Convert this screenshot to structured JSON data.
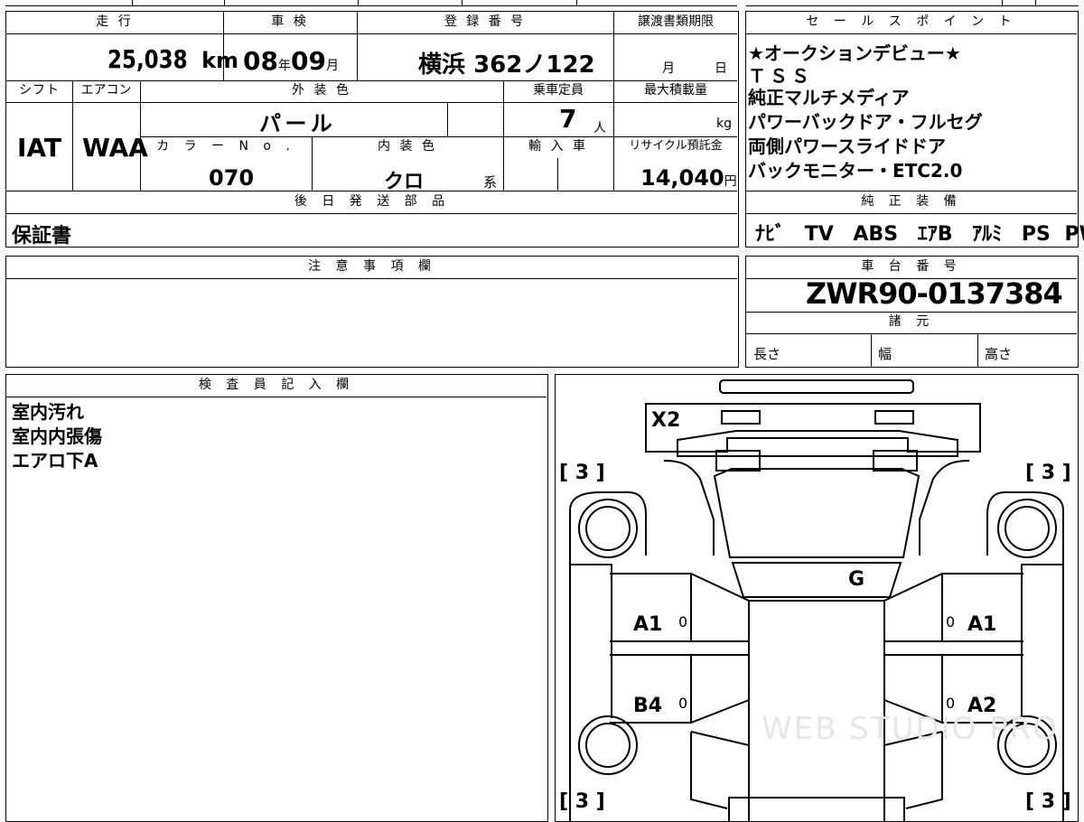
{
  "header_cells": {
    "mileage_label": "走 行",
    "inspection_label": "車 検",
    "registration_label": "登 録 番 号",
    "transfer_deadline_label": "譲渡書類期限",
    "sales_point_label": "セ ー ル ス ポ イ ン ト",
    "shift_label": "シフト",
    "aircon_label": "エアコン",
    "exterior_color_label": "外 装 色",
    "capacity_label": "乗車定員",
    "max_load_label": "最大積載量",
    "color_no_label": "カ ラ ー N o .",
    "interior_color_label": "内 装 色",
    "import_label": "輸 入 車",
    "recycle_label": "リサイクル預託金",
    "later_shipping_label": "後 日 発 送 部 品",
    "standard_equipment_label": "純 正 装 備",
    "notes_label": "注 意 事 項 欄",
    "chassis_label": "車 台 番 号",
    "specs_label": "諸 元",
    "inspector_label": "検 査 員 記 入 欄"
  },
  "vehicle": {
    "mileage": "25,038",
    "mileage_unit": "km",
    "inspection_year": "08",
    "year_unit": "年",
    "inspection_month": "09",
    "month_unit": "月",
    "plate_region": "横浜",
    "plate_number": "362ノ122",
    "deadline_month_unit": "月",
    "deadline_day_unit": "日",
    "shift": "IAT",
    "aircon": "WAA",
    "exterior_color": "パ ー ル",
    "capacity": "7",
    "capacity_unit": "人",
    "max_load_unit": "kg",
    "color_no": "070",
    "interior_color": "クロ",
    "interior_suffix": "系",
    "recycle_fee": "14,040",
    "recycle_unit": "円",
    "chassis_number": "ZWR90-0137384"
  },
  "sales_points": [
    "★オークションデビュー★",
    "ＴＳＳ",
    "純正マルチメディア",
    "パワーバックドア・フルセグ",
    "両側パワースライドドア",
    "バックモニター・ETC2.0"
  ],
  "later_shipping_items": "保証書",
  "standard_equipment": [
    "ﾅﾋﾞ",
    "TV",
    "ABS",
    "ｴｱB",
    "ｱﾙﾐ",
    "PS",
    "PW"
  ],
  "specs": {
    "length": "長さ",
    "width": "幅",
    "height": "高さ"
  },
  "inspector_notes": [
    "室内汚れ",
    "室内内張傷",
    "エアロ下A"
  ],
  "diagram": {
    "tire_front_left": "[ 3 ]",
    "tire_front_right": "[ 3 ]",
    "tire_rear_left": "[ 3 ]",
    "tire_rear_right": "[ 3 ]",
    "front_bumper": "X2",
    "windshield": "G",
    "left_front_door": "A1",
    "left_rear_door": "B4",
    "right_front_door": "A1",
    "right_rear_door": "A2",
    "zero": "0",
    "watermark": "WEB STUDIO PRO"
  }
}
